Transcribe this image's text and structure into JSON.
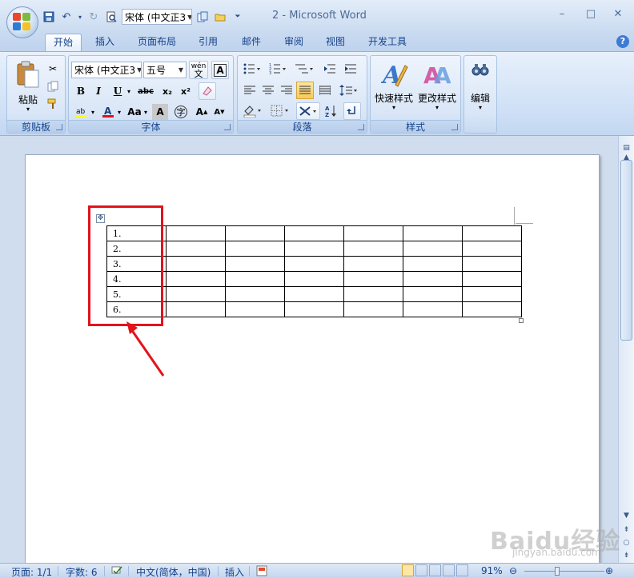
{
  "titlebar": {
    "window_title": "2 - Microsoft Word",
    "qat_font": "宋体 (中文正3",
    "icons": [
      "save-icon",
      "undo-icon",
      "redo-icon",
      "print-preview-icon",
      "copy-icon",
      "open-folder-icon",
      "customize-qat-icon"
    ]
  },
  "tabs": [
    "开始",
    "插入",
    "页面布局",
    "引用",
    "邮件",
    "审阅",
    "视图",
    "开发工具"
  ],
  "ribbon": {
    "clipboard": {
      "paste_label": "粘贴",
      "group_label": "剪贴板"
    },
    "font": {
      "font_name": "宋体 (中文正3",
      "font_size": "五号",
      "wen_label": "wén",
      "bold": "B",
      "italic": "I",
      "underline": "U",
      "strike": "abc",
      "sub": "x₂",
      "sup": "x²",
      "grow": "A",
      "shrink": "A",
      "change_case": "Aa",
      "char_shade": "A",
      "enclose": "字",
      "group_label": "字体"
    },
    "paragraph": {
      "group_label": "段落"
    },
    "styles": {
      "quick_styles": "快速样式",
      "change_styles": "更改样式",
      "group_label": "样式"
    },
    "editing": {
      "label": "编辑"
    }
  },
  "document": {
    "table": {
      "columns": 7,
      "rows": [
        [
          "1.",
          "",
          "",
          "",
          "",
          "",
          ""
        ],
        [
          "2.",
          "",
          "",
          "",
          "",
          "",
          ""
        ],
        [
          "3.",
          "",
          "",
          "",
          "",
          "",
          ""
        ],
        [
          "4.",
          "",
          "",
          "",
          "",
          "",
          ""
        ],
        [
          "5.",
          "",
          "",
          "",
          "",
          "",
          ""
        ],
        [
          "6.",
          "",
          "",
          "",
          "",
          "",
          ""
        ]
      ]
    },
    "highlight_color": "#e3131b"
  },
  "statusbar": {
    "page": "页面: 1/1",
    "words": "字数: 6",
    "language": "中文(简体，中国)",
    "mode": "插入",
    "zoom": "91%"
  },
  "watermark": {
    "text": "Baidu经验",
    "sub": "jingyan.baidu.com"
  },
  "colors": {
    "accent": "#15428b",
    "ribbon_bg": "#cfe0f6",
    "annotation": "#e3131b"
  }
}
